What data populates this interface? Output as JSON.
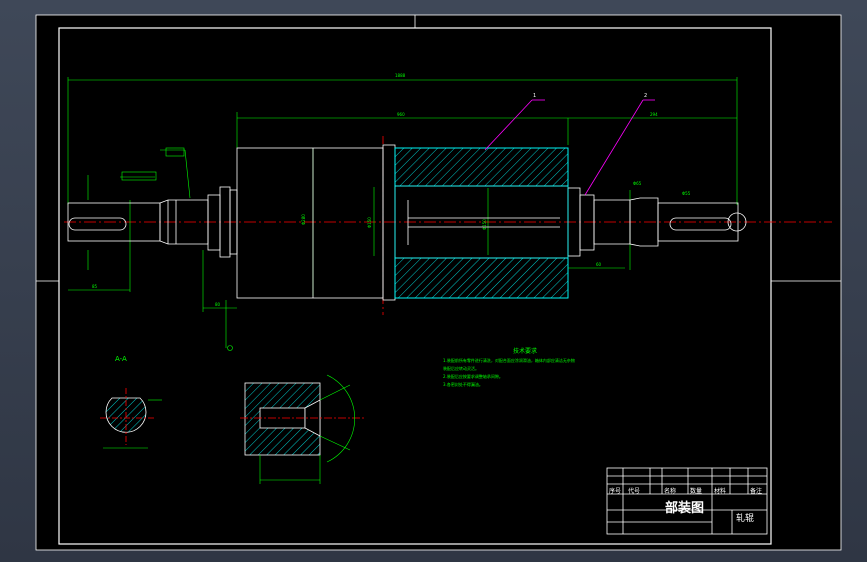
{
  "title_block": {
    "title": "部装图",
    "name_cell": "轧辊",
    "header": [
      "序号",
      "代号",
      "名称",
      "数量",
      "材料",
      "备注"
    ]
  },
  "tech_req": {
    "title": "技术要求",
    "lines": [
      "1.装配前所有零件进行清洗，对配合面应涂润滑油，箱体内部应清洁无杂物",
      "  装配后应转动灵活。",
      "2.装配后应按要求调整轴承间隙。",
      "3.各密封处不得漏油。"
    ]
  },
  "section_label": "A-A",
  "part_callouts": [
    "1",
    "2"
  ],
  "colors": {
    "background": "#000000",
    "frame": "#ffffff",
    "outline": "#ffffff",
    "dimension": "#00ff00",
    "hatch": "#00ffff",
    "leader": "#ff00ff",
    "centerline": "#ff0000"
  }
}
